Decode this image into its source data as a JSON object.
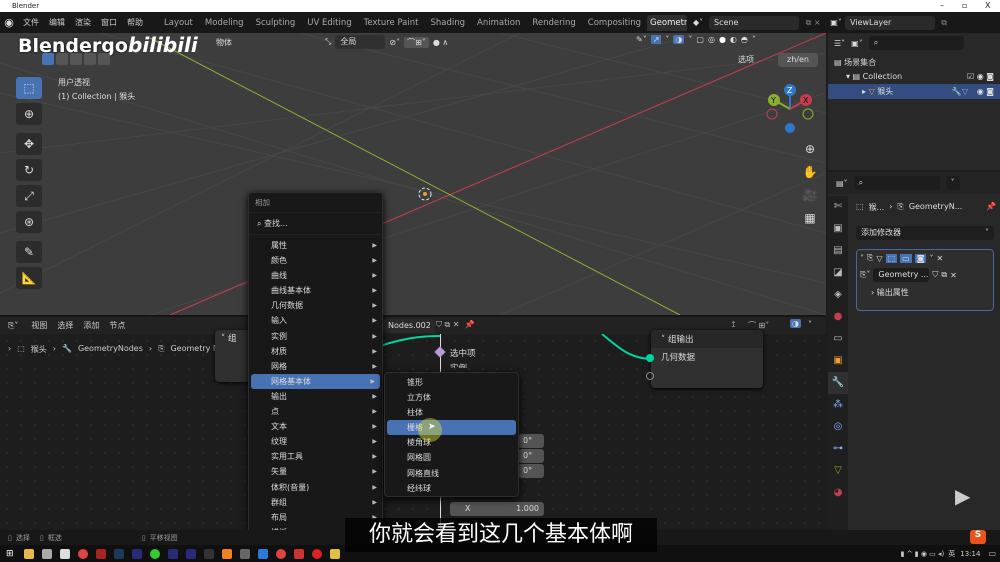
{
  "window": {
    "title": "Blender",
    "minimize": "–",
    "restore": "▫",
    "close": "X"
  },
  "menubar": {
    "items": [
      "文件",
      "编辑",
      "渲染",
      "窗口",
      "帮助"
    ],
    "workspaces": [
      "Layout",
      "Modeling",
      "Sculpting",
      "UV Editing",
      "Texture Paint",
      "Shading",
      "Animation",
      "Rendering",
      "Compositing",
      "Geometr"
    ],
    "active_workspace": "Geometr",
    "scene": "Scene",
    "view_layer": "ViewLayer"
  },
  "watermark": {
    "brand": "Blendergo",
    "logo": "bilibili"
  },
  "viewport": {
    "header_items": [
      "物体"
    ],
    "transform_orientation": "全局",
    "view_name": "用户透视",
    "collection_info": "(1) Collection | 猴头",
    "options_label": "选项",
    "lang_toggle": "zh/en",
    "gizmo_axes": [
      "Z",
      "Y",
      "X"
    ]
  },
  "outliner": {
    "root": "场景集合",
    "collection": "Collection",
    "object": "猴头"
  },
  "properties": {
    "breadcrumb_object": "猴...",
    "breadcrumb_modifier": "GeometryN...",
    "add_modifier": "添加修改器",
    "node_group": "Geometry ...",
    "output_attributes": "输出属性"
  },
  "node_editor": {
    "menu": [
      "视图",
      "选择",
      "添加",
      "节点"
    ],
    "breadcrumb": [
      "猴头",
      "GeometryNodes",
      "Geometry Nod"
    ],
    "node_group_name": "Nodes.002",
    "group_input_partial": "组",
    "group_output_title": "组输出",
    "group_output_socket": "几何数据",
    "selection_label": "选中项",
    "instance_label": "实例",
    "angle_values": [
      "0°",
      "0°",
      "0°"
    ],
    "scale_x_label": "X",
    "scale_x_value": "1.000"
  },
  "add_menu": {
    "title": "相加",
    "search": "查找...",
    "items": [
      "属性",
      "颜色",
      "曲线",
      "曲线基本体",
      "几何数据",
      "输入",
      "实例",
      "材质",
      "网格",
      "网格基本体",
      "输出",
      "点",
      "文本",
      "纹理",
      "实用工具",
      "矢量",
      "体积(音量)",
      "群组",
      "布局",
      "模板"
    ],
    "highlighted": "网格基本体"
  },
  "submenu": {
    "items": [
      "锥形",
      "立方体",
      "柱体",
      "栅格",
      "棱角球",
      "网格圆",
      "网格直线",
      "经纬球"
    ],
    "highlighted": "栅格"
  },
  "statusbar": {
    "items": [
      "选择",
      "框选",
      "平移视图"
    ]
  },
  "taskbar": {
    "ime": "英",
    "time": "13:14"
  },
  "subtitle": "你就会看到这几个基本体啊",
  "colors": {
    "accent": "#4772b3",
    "geometry_socket": "#00d6a3",
    "viewport_bg": "#3d3d3d",
    "x_axis": "#c43e4e",
    "y_axis": "#8ab02e"
  }
}
